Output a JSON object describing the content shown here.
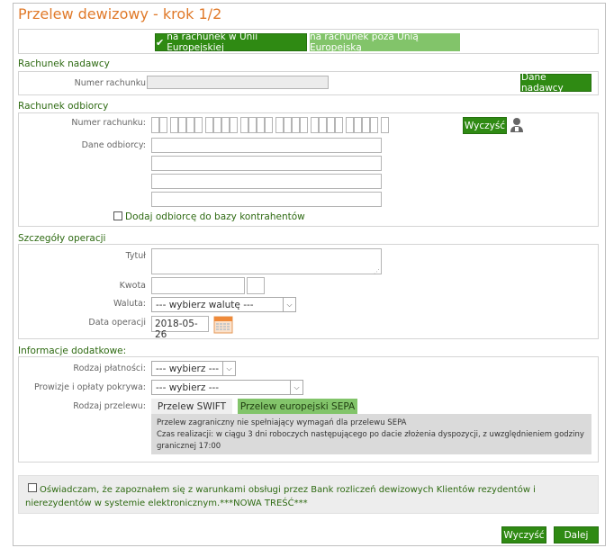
{
  "title": "Przelew dewizowy - krok 1/2",
  "toggle": {
    "eu": "na rachunek w Unii Europejskiej",
    "non_eu": "na rachunek poza Unią Europejską"
  },
  "sender": {
    "section": "Rachunek nadawcy",
    "account_label": "Numer rachunku",
    "details_button": "Dane nadawcy"
  },
  "recipient": {
    "section": "Rachunek odbiorcy",
    "account_label": "Numer rachunku:",
    "clear_button": "Wyczyść",
    "data_label": "Dane odbiorcy:",
    "add_contractor": "Dodaj odbiorcę do bazy kontrahentów"
  },
  "details": {
    "section": "Szczegóły operacji",
    "title_label": "Tytuł",
    "amount_label": "Kwota",
    "currency_label": "Waluta:",
    "currency_value": "--- wybierz walutę ---",
    "date_label": "Data operacji",
    "date_value": "2018-05-26"
  },
  "extra": {
    "section": "Informacje dodatkowe:",
    "payment_type_label": "Rodzaj płatności:",
    "payment_type_value": "--- wybierz ---",
    "fees_label": "Prowizje i opłaty pokrywa:",
    "fees_value": "--- wybierz ---",
    "transfer_type_label": "Rodzaj przelewu:",
    "tab_swift": "Przelew SWIFT",
    "tab_sepa": "Przelew europejski SEPA",
    "info_line1": "Przelew zagraniczny nie spełniający wymagań dla przelewu SEPA",
    "info_line2": "Czas realizacji: w ciągu 3 dni roboczych następującego po dacie złożenia dyspozycji, z uwzględnieniem godziny granicznej 17:00"
  },
  "consent": {
    "text": "Oświadczam, że zapoznałem się z warunkami obsługi przez Bank rozliczeń dewizowych Klientów rezydentów i nierezydentów w systemie elektronicznym.***NOWA TREŚĆ***"
  },
  "footer": {
    "clear": "Wyczyść",
    "next": "Dalej"
  },
  "colors": {
    "accent_green": "#2f8a13",
    "light_green": "#82c46a",
    "title_orange": "#e07a2a"
  }
}
